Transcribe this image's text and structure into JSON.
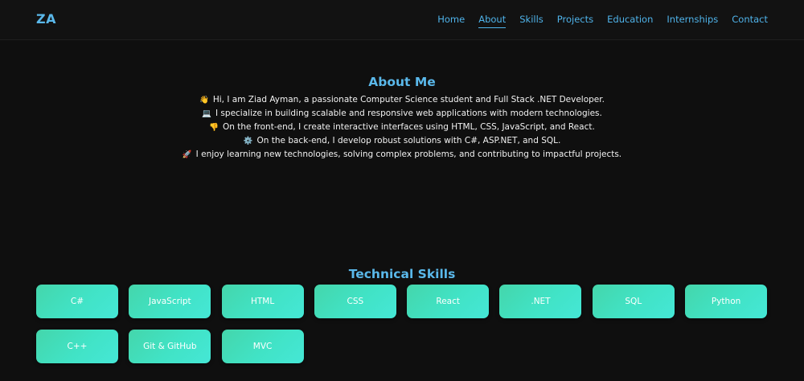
{
  "navbar": {
    "logo": "ZA",
    "links": [
      {
        "label": "Home",
        "active": false
      },
      {
        "label": "About",
        "active": true
      },
      {
        "label": "Skills",
        "active": false
      },
      {
        "label": "Projects",
        "active": false
      },
      {
        "label": "Education",
        "active": false
      },
      {
        "label": "Internships",
        "active": false
      },
      {
        "label": "Contact",
        "active": false
      }
    ]
  },
  "about": {
    "title": "About Me",
    "lines": [
      {
        "icon": "👋",
        "text": "Hi, I am Ziad Ayman, a passionate Computer Science student and Full Stack .NET Developer."
      },
      {
        "icon": "💻",
        "text": "I specialize in building scalable and responsive web applications with modern technologies."
      },
      {
        "icon": "👎",
        "text": "On the front-end, I create interactive interfaces using HTML, CSS, JavaScript, and React."
      },
      {
        "icon": "⚙️",
        "text": "On the back-end, I develop robust solutions with C#, ASP.NET, and SQL."
      },
      {
        "icon": "🚀",
        "text": "I enjoy learning new technologies, solving complex problems, and contributing to impactful projects."
      }
    ]
  },
  "skills": {
    "title": "Technical Skills",
    "items": [
      "C#",
      "JavaScript",
      "HTML",
      "CSS",
      "React",
      ".NET",
      "SQL",
      "Python",
      "C++",
      "Git & GitHub",
      "MVC"
    ]
  },
  "colors": {
    "accent": "#5ab8ea",
    "background": "#0f0f0f",
    "card_gradient_start": "#44d6ab",
    "card_gradient_end": "#45e7d6"
  }
}
